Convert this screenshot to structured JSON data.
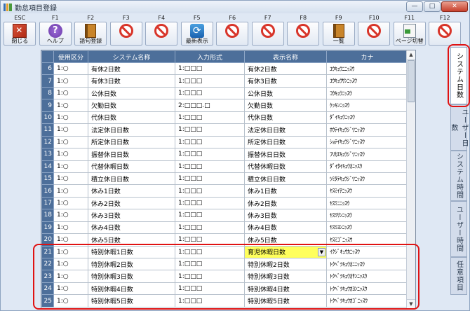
{
  "window": {
    "title": "勤怠項目登録",
    "min": "—",
    "max": "□",
    "close": "✕"
  },
  "toolbar": [
    {
      "key": "ESC",
      "label": "閉じる",
      "icon": "close-icon"
    },
    {
      "key": "F1",
      "label": "ヘルプ",
      "icon": "help-icon"
    },
    {
      "key": "F2",
      "label": "語句登録",
      "icon": "book-icon"
    },
    {
      "key": "F3",
      "label": "",
      "icon": "prohibited-icon"
    },
    {
      "key": "F4",
      "label": "",
      "icon": "prohibited-icon"
    },
    {
      "key": "F5",
      "label": "最新表示",
      "icon": "refresh-icon"
    },
    {
      "key": "F6",
      "label": "",
      "icon": "prohibited-icon"
    },
    {
      "key": "F7",
      "label": "",
      "icon": "prohibited-icon"
    },
    {
      "key": "F8",
      "label": "",
      "icon": "prohibited-icon"
    },
    {
      "key": "F9",
      "label": "一覧",
      "icon": "book-icon"
    },
    {
      "key": "F10",
      "label": "",
      "icon": "prohibited-icon"
    },
    {
      "key": "F11",
      "label": "ページ切替",
      "icon": "page-switch-icon"
    },
    {
      "key": "F12",
      "label": "",
      "icon": "prohibited-icon"
    }
  ],
  "grid": {
    "columns": [
      "",
      "使用区分",
      "システム名称",
      "入力形式",
      "表示名称",
      "カナ"
    ],
    "rows": [
      {
        "n": "6",
        "use": "1:○",
        "sys": "有休2日数",
        "fmt": "1:□□□",
        "disp": "有休2日数",
        "kana": "ﾕｳｷｭｳﾆﾆｯｽｳ"
      },
      {
        "n": "7",
        "use": "1:○",
        "sys": "有休3日数",
        "fmt": "1:□□□",
        "disp": "有休3日数",
        "kana": "ﾕｳｷｭｳｻﾝﾆｯｽｳ"
      },
      {
        "n": "8",
        "use": "1:○",
        "sys": "公休日数",
        "fmt": "1:□□□",
        "disp": "公休日数",
        "kana": "ｺｳｷｭｳﾆｯｽｳ"
      },
      {
        "n": "9",
        "use": "1:○",
        "sys": "欠勤日数",
        "fmt": "2:□□□.□",
        "disp": "欠勤日数",
        "kana": "ｹｯｷﾝﾆｯｽｳ"
      },
      {
        "n": "10",
        "use": "1:○",
        "sys": "代休日数",
        "fmt": "1:□□□",
        "disp": "代休日数",
        "kana": "ﾀﾞｲｷｭｳﾆｯｽｳ"
      },
      {
        "n": "11",
        "use": "1:○",
        "sys": "法定休日日数",
        "fmt": "1:□□□",
        "disp": "法定休日日数",
        "kana": "ﾎｳﾃｲｷｭｳｼﾞﾂﾆｯｽｳ"
      },
      {
        "n": "12",
        "use": "1:○",
        "sys": "所定休日日数",
        "fmt": "1:□□□",
        "disp": "所定休日日数",
        "kana": "ｼｮﾃｲｷｭｳｼﾞﾂﾆｯｽｳ"
      },
      {
        "n": "13",
        "use": "1:○",
        "sys": "振替休日日数",
        "fmt": "1:□□□",
        "disp": "振替休日日数",
        "kana": "ﾌﾘｶｴｷｭｳｼﾞﾂﾆｯｽｳ"
      },
      {
        "n": "14",
        "use": "1:○",
        "sys": "代替休暇日数",
        "fmt": "1:□□□",
        "disp": "代替休暇日数",
        "kana": "ﾀﾞｲﾀｲｷｭｳｶﾆｯｽｳ"
      },
      {
        "n": "15",
        "use": "1:○",
        "sys": "積立休日日数",
        "fmt": "1:□□□",
        "disp": "積立休日日数",
        "kana": "ﾂﾐﾀﾃｷｭｳｼﾞﾂﾆｯｽｳ"
      },
      {
        "n": "16",
        "use": "1:○",
        "sys": "休み1日数",
        "fmt": "1:□□□",
        "disp": "休み1日数",
        "kana": "ﾔｽﾐｲﾁﾆｯｽｳ"
      },
      {
        "n": "17",
        "use": "1:○",
        "sys": "休み2日数",
        "fmt": "1:□□□",
        "disp": "休み2日数",
        "kana": "ﾔｽﾐﾆﾆｯｽｳ"
      },
      {
        "n": "18",
        "use": "1:○",
        "sys": "休み3日数",
        "fmt": "1:□□□",
        "disp": "休み3日数",
        "kana": "ﾔｽﾐｻﾝﾆｯｽｳ"
      },
      {
        "n": "19",
        "use": "1:○",
        "sys": "休み4日数",
        "fmt": "1:□□□",
        "disp": "休み4日数",
        "kana": "ﾔｽﾐﾖﾝﾆｯｽｳ"
      },
      {
        "n": "20",
        "use": "1:○",
        "sys": "休み5日数",
        "fmt": "1:□□□",
        "disp": "休み5日数",
        "kana": "ﾔｽﾐｺﾞﾆｯｽｳ"
      },
      {
        "n": "21",
        "use": "1:○",
        "sys": "特別休暇1日数",
        "fmt": "1:□□□",
        "disp": "育児休暇日数",
        "kana": "ｲｸｼﾞｷｭｳｶﾆｯｽｳ",
        "selected": true
      },
      {
        "n": "22",
        "use": "1:○",
        "sys": "特別休暇2日数",
        "fmt": "1:□□□",
        "disp": "特別休暇2日数",
        "kana": "ﾄｸﾍﾞﾂｷｭｳｶﾆﾆｯｽｳ"
      },
      {
        "n": "23",
        "use": "1:○",
        "sys": "特別休暇3日数",
        "fmt": "1:□□□",
        "disp": "特別休暇3日数",
        "kana": "ﾄｸﾍﾞﾂｷｭｳｶｻﾝﾆｯｽｳ"
      },
      {
        "n": "24",
        "use": "1:○",
        "sys": "特別休暇4日数",
        "fmt": "1:□□□",
        "disp": "特別休暇4日数",
        "kana": "ﾄｸﾍﾞﾂｷｭｳｶﾖﾝﾆｯｽｳ"
      },
      {
        "n": "25",
        "use": "1:○",
        "sys": "特別休暇5日数",
        "fmt": "1:□□□",
        "disp": "特別休暇5日数",
        "kana": "ﾄｸﾍﾞﾂｷｭｳｶｺﾞﾆｯｽｳ"
      }
    ]
  },
  "side_tabs": [
    {
      "label": "システム日数",
      "active": true
    },
    {
      "label": "ユーザー日数",
      "active": false
    },
    {
      "label": "システム時間",
      "active": false
    },
    {
      "label": "ユーザー時間",
      "active": false
    },
    {
      "label": "任意項目",
      "active": false
    }
  ],
  "colors": {
    "header_blue": "#4d6f9a",
    "selected_cell": "#ffff5c",
    "highlight_red": "#e01212"
  }
}
